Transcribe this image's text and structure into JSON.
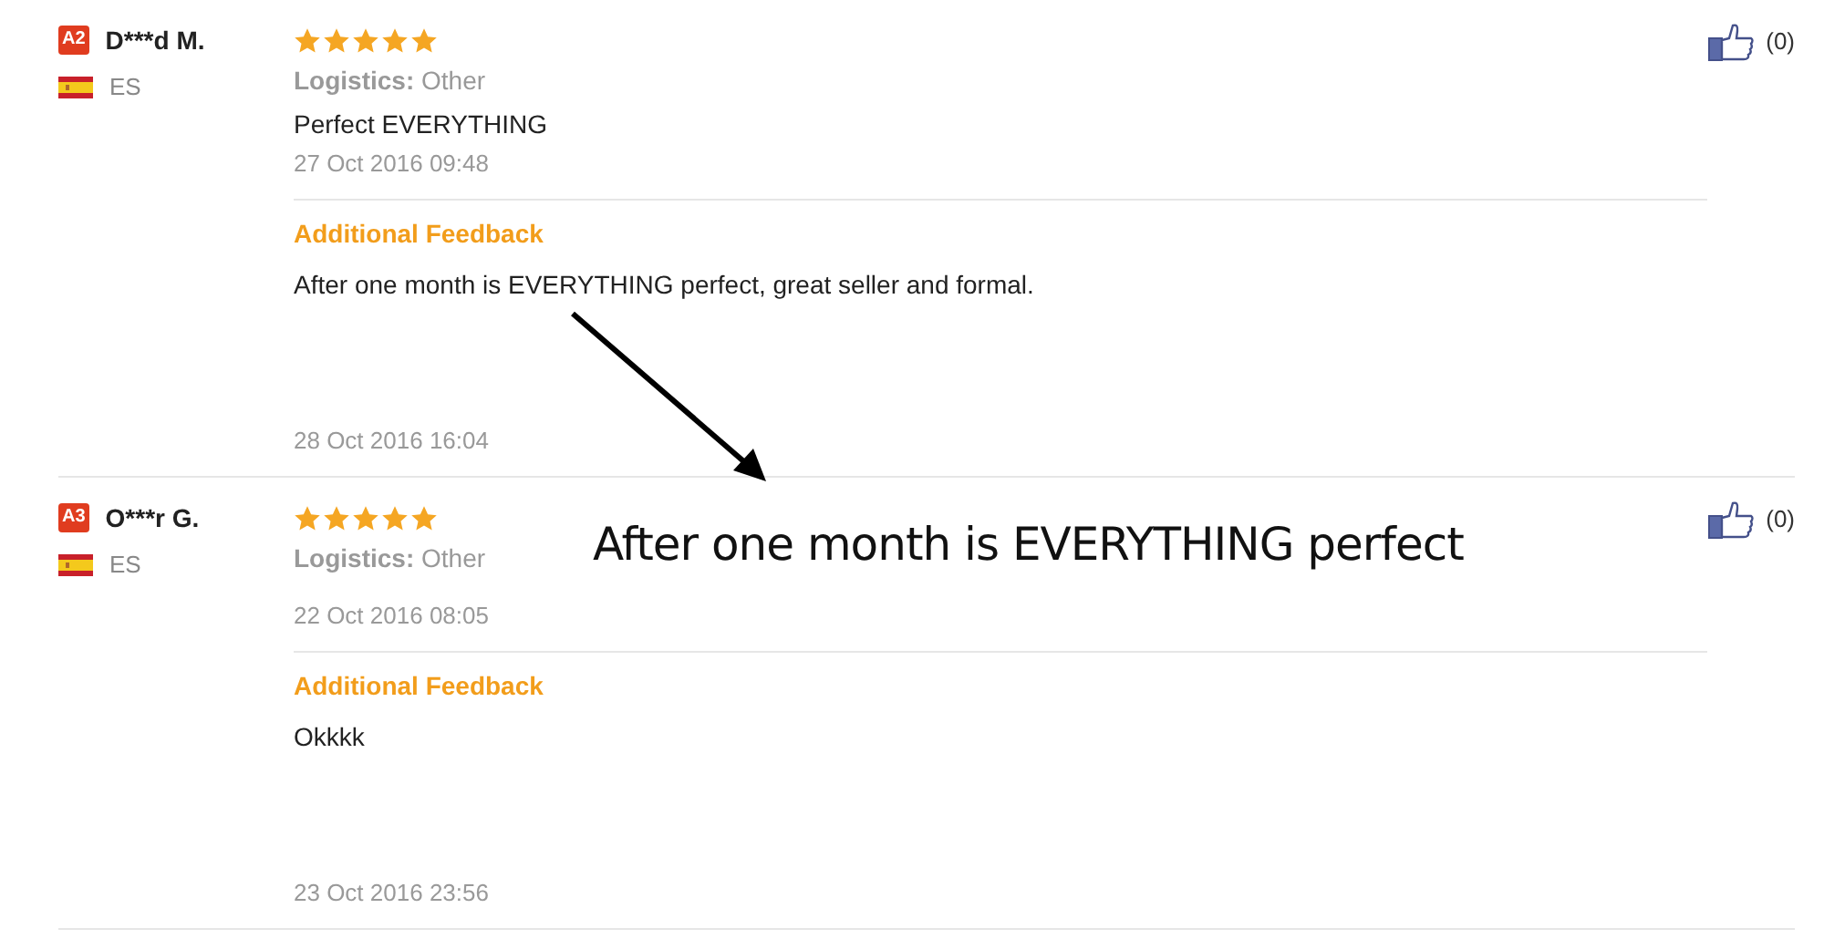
{
  "reviews": [
    {
      "badge": "A2",
      "name": "D***d M.",
      "country": "ES",
      "stars": 5,
      "logistics_label": "Logistics:",
      "logistics": "Other",
      "comment": "Perfect EVERYTHING",
      "date": "27 Oct 2016 09:48",
      "additional_feedback": {
        "heading": "Additional Feedback",
        "text": "After one month is EVERYTHING perfect, great seller and formal.",
        "date": "28 Oct 2016 16:04"
      },
      "likes": "(0)"
    },
    {
      "badge": "A3",
      "name": "O***r G.",
      "country": "ES",
      "stars": 5,
      "logistics_label": "Logistics:",
      "logistics": "Other",
      "date": "22 Oct 2016 08:05",
      "additional_feedback": {
        "heading": "Additional Feedback",
        "text": "Okkkk",
        "date": "23 Oct 2016 23:56"
      },
      "likes": "(0)"
    }
  ],
  "annotation": {
    "text": "After one month is EVERYTHING perfect"
  }
}
